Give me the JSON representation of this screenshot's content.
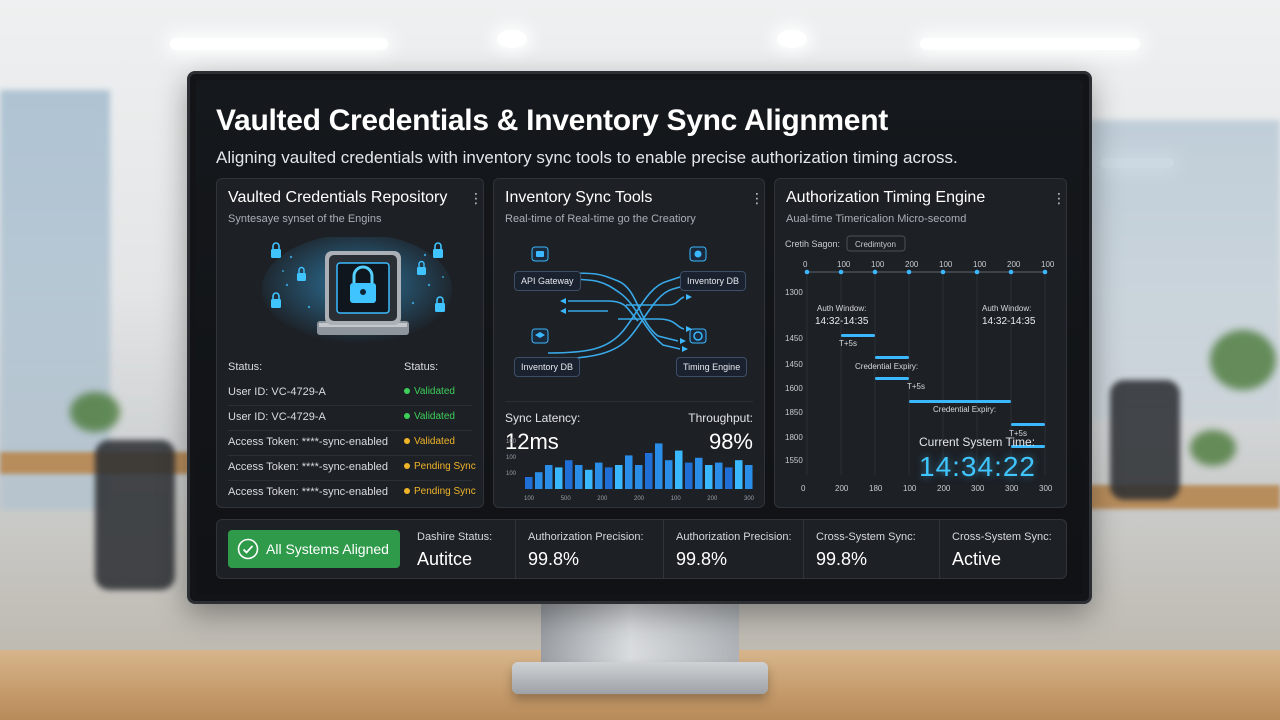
{
  "header": {
    "title": "Vaulted Credentials & Inventory Sync Alignment",
    "subtitle": "Aligning vaulted credentials with inventory sync tools to enable precise authorization timing across."
  },
  "vault_card": {
    "title": "Vaulted Credentials Repository",
    "subtitle": "Syntesaye synset of the Engins",
    "status_header_left": "Status:",
    "status_header_right": "Status:",
    "rows": [
      {
        "label": "User ID: VC-4729-A",
        "status": "Validated",
        "color": "#3ecf5a"
      },
      {
        "label": "User ID: VC-4729-A",
        "status": "Validated",
        "color": "#3ecf5a"
      },
      {
        "label": "Access Token: ****-sync-enabled",
        "status": "Validated",
        "color": "#f0b429"
      },
      {
        "label": "Access Token: ****-sync-enabled",
        "status": "Pending Sync",
        "color": "#f0b429"
      },
      {
        "label": "Access Token: ****-sync-enabled",
        "status": "Pending Sync",
        "color": "#f0b429"
      }
    ]
  },
  "sync_card": {
    "title": "Inventory Sync Tools",
    "subtitle": "Real-time of Real-time go the Creatiory",
    "nodes": [
      "API Gateway",
      "Inventory DB",
      "Inventory DB",
      "Timing Engine"
    ],
    "latency_label": "Sync Latency:",
    "latency_value": "12ms",
    "throughput_label": "Throughput:",
    "throughput_value": "98%",
    "hist_y_ticks": [
      "100",
      "100",
      "100"
    ],
    "hist_x_ticks": [
      "100",
      "500",
      "200",
      "200",
      "100",
      "200",
      "300"
    ],
    "hist_values": [
      0.25,
      0.35,
      0.5,
      0.45,
      0.6,
      0.5,
      0.4,
      0.55,
      0.45,
      0.5,
      0.7,
      0.5,
      0.75,
      0.95,
      0.6,
      0.8,
      0.55,
      0.65,
      0.5,
      0.55,
      0.45,
      0.6,
      0.5
    ]
  },
  "timing_card": {
    "title": "Authorization Timing Engine",
    "subtitle": "Aual-time Timericalion Micro-secomd",
    "scale_label": "Cretih Sagon:",
    "scale_chip": "Credimtyon",
    "top_ticks": [
      "0",
      "100",
      "100",
      "200",
      "100",
      "100",
      "200",
      "100"
    ],
    "bottom_ticks": [
      "0",
      "200",
      "180",
      "100",
      "200",
      "300",
      "300",
      "300"
    ],
    "row_labels": [
      "1300",
      "1450",
      "1450",
      "1600",
      "1850",
      "1800",
      "1550"
    ],
    "window_label_left": "Auth Window:",
    "window_time_left": "14:32-14:35",
    "window_label_right": "Auth Window:",
    "window_time_right": "14:32-14:35",
    "annotations": [
      "T+5s",
      "Credential Expiry:",
      "T+5s",
      "Credential Expiry:",
      "T+5s"
    ],
    "clock_label": "Current System Time:",
    "clock_value": "14:34:22",
    "accent": "#40c6ff"
  },
  "bottom_bar": {
    "aligned_label": "All Systems Aligned",
    "aligned_color": "#2f9a4a",
    "stats": [
      {
        "label": "Dashire Status:",
        "value": "Autitce"
      },
      {
        "label": "Authorization Precision:",
        "value": "99.8%"
      },
      {
        "label": "Authorization Precision:",
        "value": "99.8%"
      },
      {
        "label": "Cross-System Sync:",
        "value": "99.8%"
      },
      {
        "label": "Cross-System Sync:",
        "value": "Active"
      }
    ]
  }
}
